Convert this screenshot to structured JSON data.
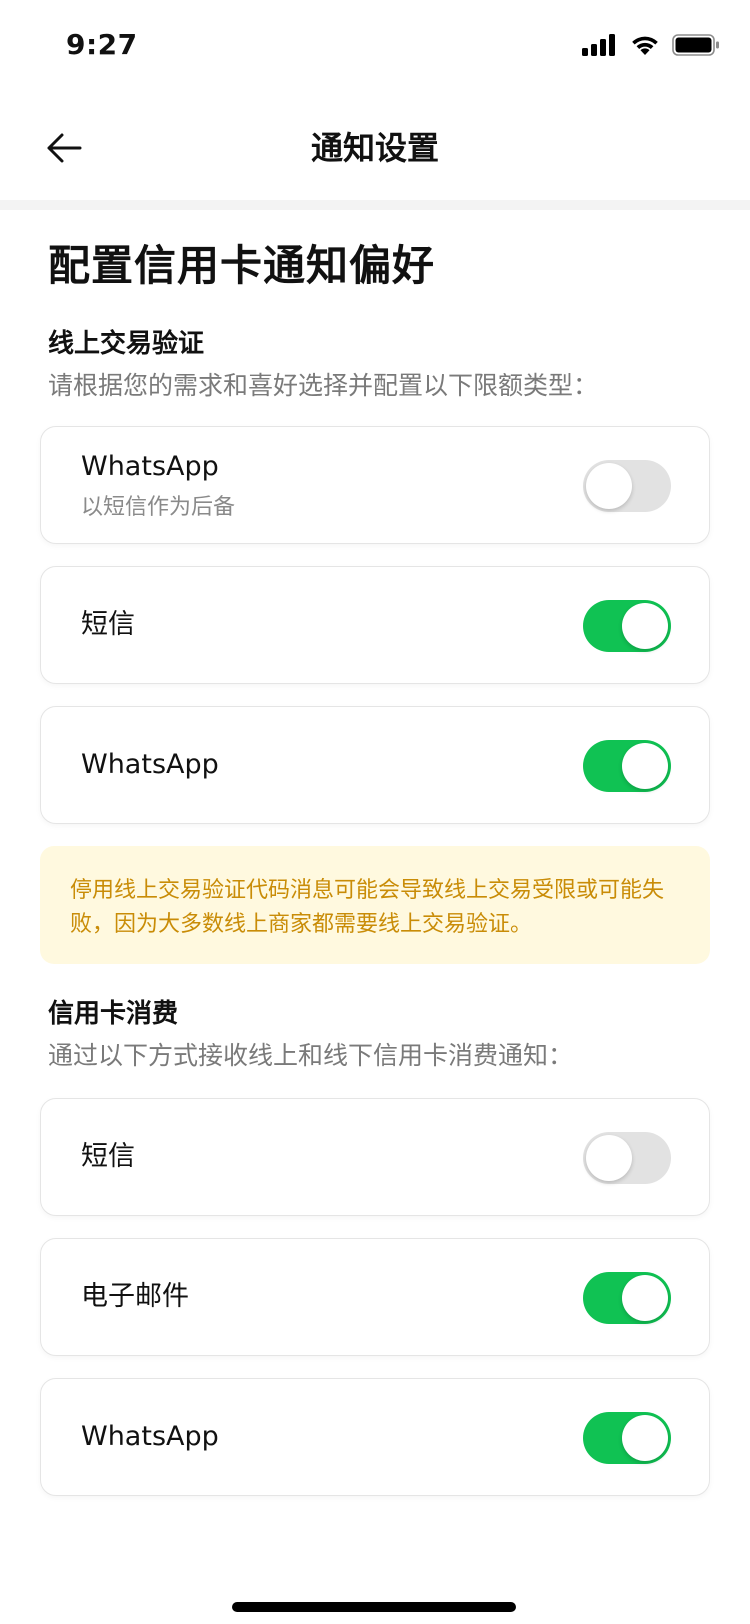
{
  "status": {
    "time": "9:27"
  },
  "nav": {
    "title": "通知设置"
  },
  "page": {
    "heading": "配置信用卡通知偏好"
  },
  "sections": [
    {
      "title": "线上交易验证",
      "subtitle": "请根据您的需求和喜好选择并配置以下限额类型：",
      "options": [
        {
          "label": "WhatsApp",
          "sublabel": "以短信作为后备",
          "enabled": false
        },
        {
          "label": "短信",
          "enabled": true
        },
        {
          "label": "WhatsApp",
          "enabled": true
        }
      ],
      "warning": "停用线上交易验证代码消息可能会导致线上交易受限或可能失败，因为大多数线上商家都需要线上交易验证。"
    },
    {
      "title": "信用卡消费",
      "subtitle": "通过以下方式接收线上和线下信用卡消费通知：",
      "options": [
        {
          "label": "短信",
          "enabled": false
        },
        {
          "label": "电子邮件",
          "enabled": true
        },
        {
          "label": "WhatsApp",
          "enabled": true
        }
      ]
    }
  ],
  "colors": {
    "toggle_on": "#10c253",
    "toggle_off": "#e2e2e2",
    "warning_bg": "#fff9df",
    "warning_text": "#c98c07"
  },
  "icons": {
    "back": "arrow-left-icon",
    "signal": "signal-icon",
    "wifi": "wifi-icon",
    "battery": "battery-icon"
  }
}
